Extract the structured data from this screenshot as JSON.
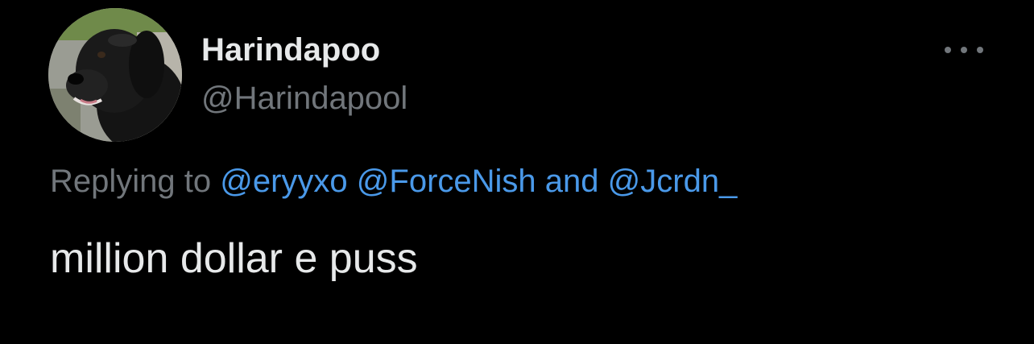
{
  "tweet": {
    "author": {
      "display_name": "Harindapoo",
      "handle": "@Harindapool",
      "avatar_description": "black-dog-photo"
    },
    "more_icon": "more-horizontal-icon",
    "reply": {
      "prefix": "Replying to",
      "mentions": [
        "@eryyxo",
        "@ForceNish",
        "@Jcrdn_"
      ],
      "conjunction": "and"
    },
    "text": "million dollar e puss"
  },
  "colors": {
    "background": "#000000",
    "primary_text": "#e7e9ea",
    "secondary_text": "#71767b",
    "link": "#4a99e9"
  }
}
